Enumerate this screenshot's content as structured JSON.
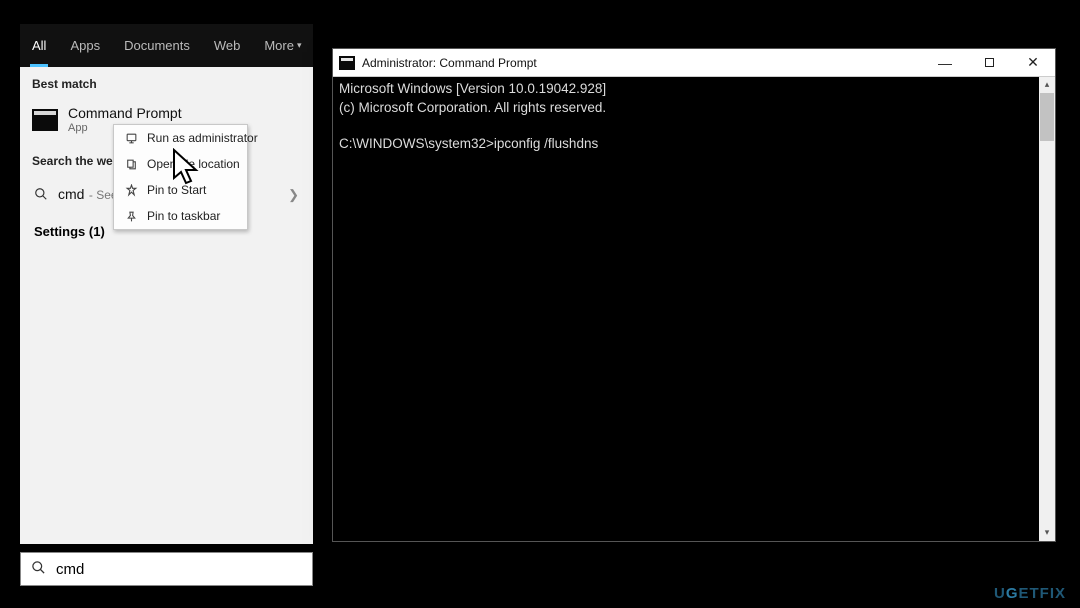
{
  "search_panel": {
    "tabs": [
      "All",
      "Apps",
      "Documents",
      "Web",
      "More"
    ],
    "active_tab_index": 0,
    "best_match_label": "Best match",
    "best_match": {
      "title": "Command Prompt",
      "subtitle": "App"
    },
    "search_web_label": "Search the web",
    "web_result": {
      "term": "cmd",
      "hint": "- See",
      "settings_label": "Settings (1)"
    },
    "input_value": "cmd"
  },
  "context_menu": {
    "items": [
      {
        "icon": "admin",
        "label": "Run as administrator"
      },
      {
        "icon": "folder",
        "label": "Open file location"
      },
      {
        "icon": "pin",
        "label": "Pin to Start"
      },
      {
        "icon": "pin",
        "label": "Pin to taskbar"
      }
    ]
  },
  "cmd": {
    "title": "Administrator: Command Prompt",
    "line1": "Microsoft Windows [Version 10.0.19042.928]",
    "line2": "(c) Microsoft Corporation. All rights reserved.",
    "prompt_line": "C:\\WINDOWS\\system32>ipconfig /flushdns"
  },
  "watermark": "UGETFIX"
}
